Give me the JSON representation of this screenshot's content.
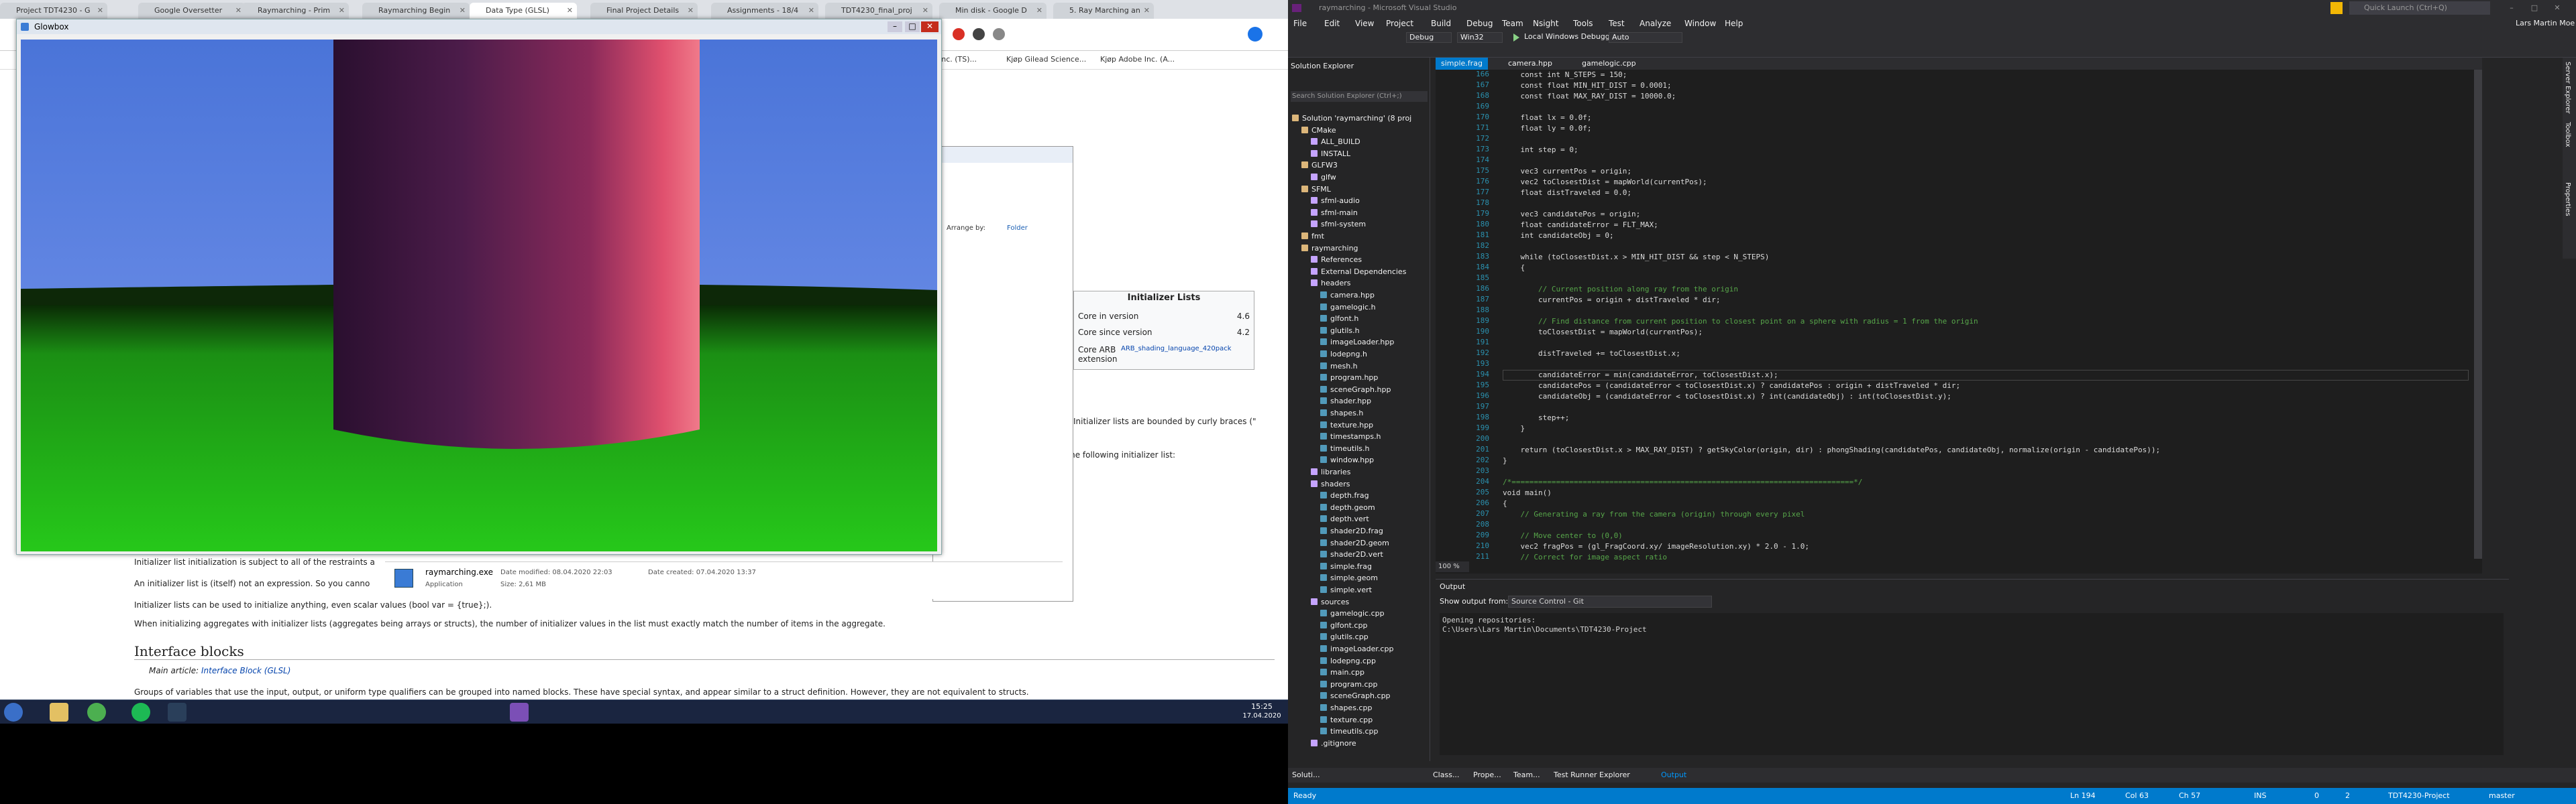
{
  "browser": {
    "tabs": [
      {
        "label": "Project TDT4230 - G"
      },
      {
        "label": "Google Oversetter"
      },
      {
        "label": "Raymarching - Prim"
      },
      {
        "label": "Raymarching Begin"
      },
      {
        "label": "Data Type (GLSL)"
      },
      {
        "label": "Final Project Details"
      },
      {
        "label": "Assignments - 18/4"
      },
      {
        "label": "TDT4230_final_proj"
      },
      {
        "label": "Min disk - Google D"
      },
      {
        "label": "5. Ray Marching an"
      }
    ],
    "bookmarks": [
      "Inc. (TS)...",
      "Kjøp Gilead Science...",
      "Kjøp Adobe Inc. (A..."
    ],
    "wiki": {
      "section_title": "Initializer Lists",
      "info_rows": [
        {
          "label": "Core in version",
          "value": "4.6"
        },
        {
          "label": "Core since version",
          "value": "4.2"
        },
        {
          "label": "Core ARB extension",
          "value": "ARB_shading_language_420pack"
        }
      ],
      "para_bounded": "Initializer lists are bounded by curly braces (\"",
      "para_following": "nted with the following initializer list:",
      "para_subject": "Initializer list initialization is subject to all of the restraints a",
      "para_expression": "An initializer list is (itself) not an expression. So you canno",
      "para_scalar": "Initializer lists can be used to initialize anything, even scalar values (bool var = {true};).",
      "para_aggregates": "When initializing aggregates with initializer lists (aggregates being arrays or structs), the number of initializer values in the list must exactly match the number of items in the aggregate.",
      "interface_heading": "Interface blocks",
      "main_article_prefix": "Main article: ",
      "main_article_link": "Interface Block (GLSL)",
      "para_groups": "Groups of variables that use the input, output, or uniform type qualifiers can be grouped into named blocks. These have special syntax, and appear similar to a struct definition. However, they are not equivalent to structs."
    }
  },
  "glowbox": {
    "title": "Glowbox"
  },
  "explorer": {
    "arrange_by_label": "Arrange by:",
    "arrange_by_value": "Folder",
    "file_name": "raymarching.exe",
    "date_modified": "Date modified: 08.04.2020 22:03",
    "date_created": "Date created: 07.04.2020 13:37",
    "file_type": "Application",
    "file_size": "Size: 2,61 MB"
  },
  "taskbar": {
    "time": "15:25",
    "date": "17.04.2020"
  },
  "vs": {
    "title": "raymarching - Microsoft Visual Studio",
    "search_placeholder": "Quick Launch (Ctrl+Q)",
    "user": "Lars Martin Moe",
    "menu": [
      "File",
      "Edit",
      "View",
      "Project",
      "Build",
      "Debug",
      "Team",
      "Nsight",
      "Tools",
      "Test",
      "Analyze",
      "Window",
      "Help"
    ],
    "config": "Debug",
    "platform": "Win32",
    "debugger": "Local Windows Debugger",
    "debugger_mode": "Auto",
    "solution_explorer_title": "Solution Explorer",
    "solution_search": "Search Solution Explorer (Ctrl+;)",
    "solution_tree": [
      {
        "label": "Solution 'raymarching' (8 proj",
        "depth": 0
      },
      {
        "label": "CMake",
        "depth": 1
      },
      {
        "label": "ALL_BUILD",
        "depth": 2
      },
      {
        "label": "INSTALL",
        "depth": 2
      },
      {
        "label": "GLFW3",
        "depth": 1
      },
      {
        "label": "glfw",
        "depth": 2
      },
      {
        "label": "SFML",
        "depth": 1
      },
      {
        "label": "sfml-audio",
        "depth": 2
      },
      {
        "label": "sfml-main",
        "depth": 2
      },
      {
        "label": "sfml-system",
        "depth": 2
      },
      {
        "label": "fmt",
        "depth": 1
      },
      {
        "label": "raymarching",
        "depth": 1
      },
      {
        "label": "References",
        "depth": 2
      },
      {
        "label": "External Dependencies",
        "depth": 2
      },
      {
        "label": "headers",
        "depth": 2
      },
      {
        "label": "camera.hpp",
        "depth": 3
      },
      {
        "label": "gamelogic.h",
        "depth": 3
      },
      {
        "label": "glfont.h",
        "depth": 3
      },
      {
        "label": "glutils.h",
        "depth": 3
      },
      {
        "label": "imageLoader.hpp",
        "depth": 3
      },
      {
        "label": "lodepng.h",
        "depth": 3
      },
      {
        "label": "mesh.h",
        "depth": 3
      },
      {
        "label": "program.hpp",
        "depth": 3
      },
      {
        "label": "sceneGraph.hpp",
        "depth": 3
      },
      {
        "label": "shader.hpp",
        "depth": 3
      },
      {
        "label": "shapes.h",
        "depth": 3
      },
      {
        "label": "texture.hpp",
        "depth": 3
      },
      {
        "label": "timestamps.h",
        "depth": 3
      },
      {
        "label": "timeutils.h",
        "depth": 3
      },
      {
        "label": "window.hpp",
        "depth": 3
      },
      {
        "label": "libraries",
        "depth": 2
      },
      {
        "label": "shaders",
        "depth": 2
      },
      {
        "label": "depth.frag",
        "depth": 3
      },
      {
        "label": "depth.geom",
        "depth": 3
      },
      {
        "label": "depth.vert",
        "depth": 3
      },
      {
        "label": "shader2D.frag",
        "depth": 3
      },
      {
        "label": "shader2D.geom",
        "depth": 3
      },
      {
        "label": "shader2D.vert",
        "depth": 3
      },
      {
        "label": "simple.frag",
        "depth": 3
      },
      {
        "label": "simple.geom",
        "depth": 3
      },
      {
        "label": "simple.vert",
        "depth": 3
      },
      {
        "label": "sources",
        "depth": 2
      },
      {
        "label": "gamelogic.cpp",
        "depth": 3
      },
      {
        "label": "glfont.cpp",
        "depth": 3
      },
      {
        "label": "glutils.cpp",
        "depth": 3
      },
      {
        "label": "imageLoader.cpp",
        "depth": 3
      },
      {
        "label": "lodepng.cpp",
        "depth": 3
      },
      {
        "label": "main.cpp",
        "depth": 3
      },
      {
        "label": "program.cpp",
        "depth": 3
      },
      {
        "label": "sceneGraph.cpp",
        "depth": 3
      },
      {
        "label": "shapes.cpp",
        "depth": 3
      },
      {
        "label": "texture.cpp",
        "depth": 3
      },
      {
        "label": "timeutils.cpp",
        "depth": 3
      },
      {
        "label": ".gitignore",
        "depth": 2
      }
    ],
    "editor_tabs": [
      "simple.frag",
      "camera.hpp",
      "gamelogic.cpp"
    ],
    "code_lines": [
      {
        "n": "166",
        "t": "    const int N_STEPS = 150;"
      },
      {
        "n": "167",
        "t": "    const float MIN_HIT_DIST = 0.0001;"
      },
      {
        "n": "168",
        "t": "    const float MAX_RAY_DIST = 10000.0;"
      },
      {
        "n": "169",
        "t": ""
      },
      {
        "n": "170",
        "t": "    float lx = 0.0f;"
      },
      {
        "n": "171",
        "t": "    float ly = 0.0f;"
      },
      {
        "n": "172",
        "t": ""
      },
      {
        "n": "173",
        "t": "    int step = 0;"
      },
      {
        "n": "174",
        "t": ""
      },
      {
        "n": "175",
        "t": "    vec3 currentPos = origin;"
      },
      {
        "n": "176",
        "t": "    vec2 toClosestDist = mapWorld(currentPos);"
      },
      {
        "n": "177",
        "t": "    float distTraveled = 0.0;"
      },
      {
        "n": "178",
        "t": ""
      },
      {
        "n": "179",
        "t": "    vec3 candidatePos = origin;"
      },
      {
        "n": "180",
        "t": "    float candidateError = FLT_MAX;"
      },
      {
        "n": "181",
        "t": "    int candidateObj = 0;"
      },
      {
        "n": "182",
        "t": ""
      },
      {
        "n": "183",
        "t": "    while (toClosestDist.x > MIN_HIT_DIST && step < N_STEPS)"
      },
      {
        "n": "184",
        "t": "    {"
      },
      {
        "n": "185",
        "t": ""
      },
      {
        "n": "186",
        "t": "        // Current position along ray from the origin"
      },
      {
        "n": "187",
        "t": "        currentPos = origin + distTraveled * dir;"
      },
      {
        "n": "188",
        "t": ""
      },
      {
        "n": "189",
        "t": "        // Find distance from current position to closest point on a sphere with radius = 1 from the origin"
      },
      {
        "n": "190",
        "t": "        toClosestDist = mapWorld(currentPos);"
      },
      {
        "n": "191",
        "t": ""
      },
      {
        "n": "192",
        "t": "        distTraveled += toClosestDist.x;"
      },
      {
        "n": "193",
        "t": ""
      },
      {
        "n": "194",
        "t": "        candidateError = min(candidateError, toClosestDist.x);"
      },
      {
        "n": "195",
        "t": "        candidatePos = (candidateError < toClosestDist.x) ? candidatePos : origin + distTraveled * dir;"
      },
      {
        "n": "196",
        "t": "        candidateObj = (candidateError < toClosestDist.x) ? int(candidateObj) : int(toClosestDist.y);"
      },
      {
        "n": "197",
        "t": ""
      },
      {
        "n": "198",
        "t": "        step++;"
      },
      {
        "n": "199",
        "t": "    }"
      },
      {
        "n": "200",
        "t": ""
      },
      {
        "n": "201",
        "t": "    return (toClosestDist.x > MAX_RAY_DIST) ? getSkyColor(origin, dir) : phongShading(candidatePos, candidateObj, normalize(origin - candidatePos));"
      },
      {
        "n": "202",
        "t": "}"
      },
      {
        "n": "203",
        "t": ""
      },
      {
        "n": "204",
        "t": "/*=============================================================================*/"
      },
      {
        "n": "205",
        "t": "void main()"
      },
      {
        "n": "206",
        "t": "{"
      },
      {
        "n": "207",
        "t": "    // Generating a ray from the camera (origin) through every pixel"
      },
      {
        "n": "208",
        "t": ""
      },
      {
        "n": "209",
        "t": "    // Move center to (0,0)"
      },
      {
        "n": "210",
        "t": "    vec2 fragPos = (gl_FragCoord.xy/ imageResolution.xy) * 2.0 - 1.0;"
      },
      {
        "n": "211",
        "t": "    // Correct for image aspect ratio"
      }
    ],
    "zoom": "100 %",
    "output_title": "Output",
    "output_from_label": "Show output from:",
    "output_from_value": "Source Control - Git",
    "output_lines": [
      "Opening repositories:",
      "C:\\Users\\Lars Martin\\Documents\\TDT4230-Project"
    ],
    "bottom_tabs": [
      "Soluti...",
      "Class...",
      "Prope...",
      "Team...",
      "Test Runner Explorer",
      "Output"
    ],
    "status": {
      "ready": "Ready",
      "ln": "Ln 194",
      "col": "Col 63",
      "ch": "Ch 57",
      "ins": "INS",
      "errors": "0",
      "changes": "2",
      "project": "TDT4230-Project",
      "branch": "master"
    },
    "right_rail": [
      "Server Explorer",
      "Toolbox",
      "Properties"
    ]
  }
}
